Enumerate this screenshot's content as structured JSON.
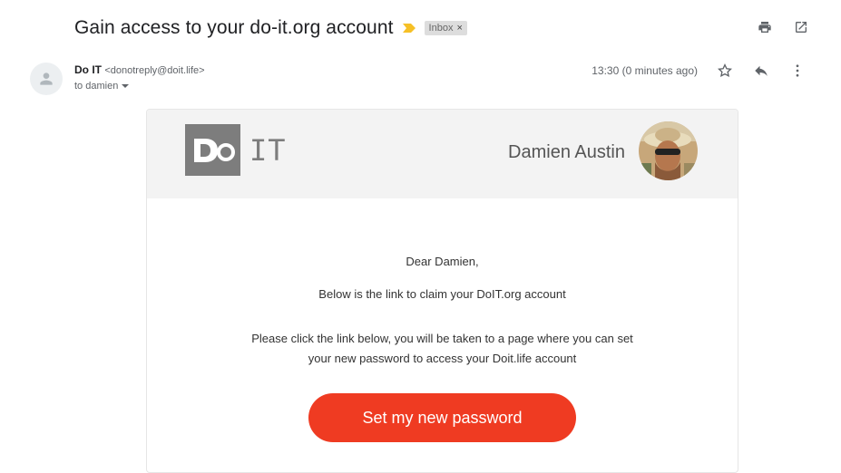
{
  "email": {
    "subject": "Gain access to your do-it.org account",
    "label": "Inbox",
    "label_close": "×",
    "sender_name": "Do IT",
    "sender_email": "<donotreply@doit.life>",
    "to_line": "to damien",
    "timestamp": "13:30 (0 minutes ago)"
  },
  "card": {
    "logo_text": "IT",
    "user_name": "Damien Austin",
    "greeting": "Dear Damien,",
    "line1": "Below is the link to claim your DoIT.org account",
    "para_line1": "Please click the link below, you will be taken to a page where you can set",
    "para_line2": "your new password to access your Doit.life account",
    "cta": "Set my new password"
  },
  "colors": {
    "cta_bg": "#ef3b22",
    "importance": "#f6c026",
    "logo_gray": "#7d7d7d"
  },
  "icons": {
    "print": "print-icon",
    "open_new": "open-in-new-icon",
    "star": "star-icon",
    "reply": "reply-icon",
    "more": "more-vert-icon",
    "caret": "caret-down-icon",
    "avatar": "person-icon"
  }
}
